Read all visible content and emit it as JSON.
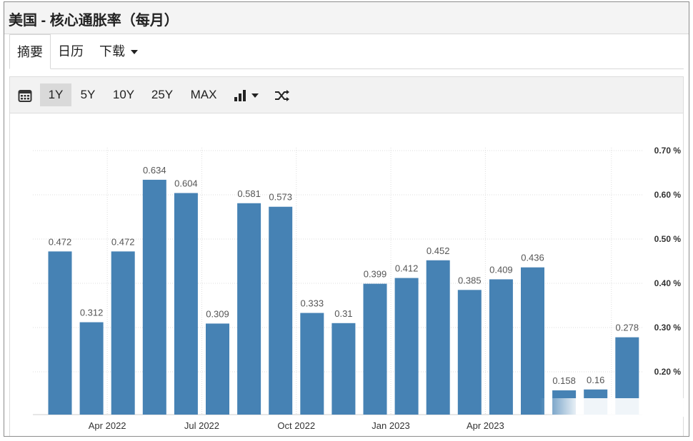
{
  "header": {
    "title": "美国 - 核心通胀率（每月）"
  },
  "tabs": [
    {
      "label": "摘要",
      "active": true
    },
    {
      "label": "日历",
      "active": false
    },
    {
      "label": "下载",
      "active": false,
      "dropdown": true
    }
  ],
  "toolbar": {
    "calendar_icon": "calendar-icon",
    "ranges": [
      {
        "label": "1Y",
        "active": true
      },
      {
        "label": "5Y",
        "active": false
      },
      {
        "label": "10Y",
        "active": false
      },
      {
        "label": "25Y",
        "active": false
      },
      {
        "label": "MAX",
        "active": false
      }
    ],
    "chart_type_icon": "bar-chart-icon",
    "compare_icon": "shuffle-icon"
  },
  "colors": {
    "bar": "#4682b4",
    "grid": "#dddddd",
    "text": "#333333"
  },
  "chart_data": {
    "type": "bar",
    "title": "",
    "xlabel": "",
    "ylabel": "",
    "y_axis_position": "right",
    "ylim": [
      0.1,
      0.7
    ],
    "yticks": [
      "0.20 %",
      "0.30 %",
      "0.40 %",
      "0.50 %",
      "0.60 %",
      "0.70 %"
    ],
    "ytick_values": [
      0.2,
      0.3,
      0.4,
      0.5,
      0.6,
      0.7
    ],
    "x_ticks": [
      "Apr 2022",
      "Jul 2022",
      "Oct 2022",
      "Jan 2023",
      "Apr 2023"
    ],
    "x_tick_after_bar": [
      2,
      5,
      8,
      11,
      14
    ],
    "values": [
      0.472,
      0.312,
      0.472,
      0.634,
      0.604,
      0.309,
      0.581,
      0.573,
      0.333,
      0.31,
      0.399,
      0.412,
      0.452,
      0.385,
      0.409,
      0.436,
      0.158,
      0.16,
      0.278
    ],
    "labels": [
      "0.472",
      "0.312",
      "0.472",
      "0.634",
      "0.604",
      "0.309",
      "0.581",
      "0.573",
      "0.333",
      "0.31",
      "0.399",
      "0.412",
      "0.452",
      "0.385",
      "0.409",
      "0.436",
      "0.158",
      "0.16",
      "0.278"
    ],
    "grid": true,
    "legend": "none"
  }
}
